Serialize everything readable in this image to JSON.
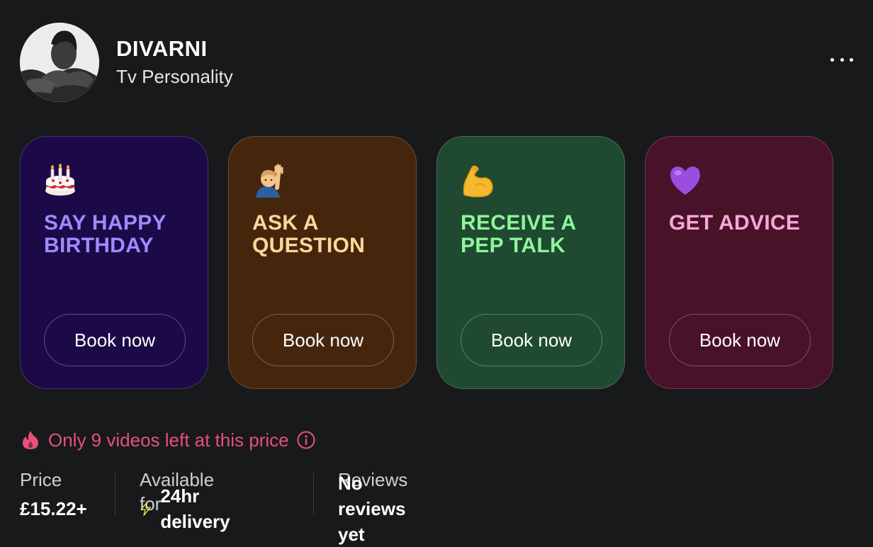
{
  "profile": {
    "name": "DIVARNI",
    "role": "Tv Personality"
  },
  "cards": [
    {
      "icon": "birthday-cake-icon",
      "title": "SAY HAPPY BIRTHDAY",
      "button": "Book now",
      "bg": "#1b0a47",
      "accent": "#9e8bff"
    },
    {
      "icon": "person-raising-hand-icon",
      "title": "ASK A QUESTION",
      "button": "Book now",
      "bg": "#45260d",
      "accent": "#ffd79a"
    },
    {
      "icon": "flexed-biceps-icon",
      "title": "RECEIVE A PEP TALK",
      "button": "Book now",
      "bg": "#1f4a31",
      "accent": "#8ff59a"
    },
    {
      "icon": "purple-heart-icon",
      "title": "GET ADVICE",
      "button": "Book now",
      "bg": "#481229",
      "accent": "#f7a8d6"
    }
  ],
  "scarcity": {
    "text": "Only 9 videos left at this price",
    "color": "#e7507a"
  },
  "stats": {
    "price_label": "Price",
    "price_value": "£15.22+",
    "available_label": "Available for",
    "available_value": "24hr delivery",
    "reviews_label": "Reviews",
    "reviews_value": "No reviews yet"
  }
}
